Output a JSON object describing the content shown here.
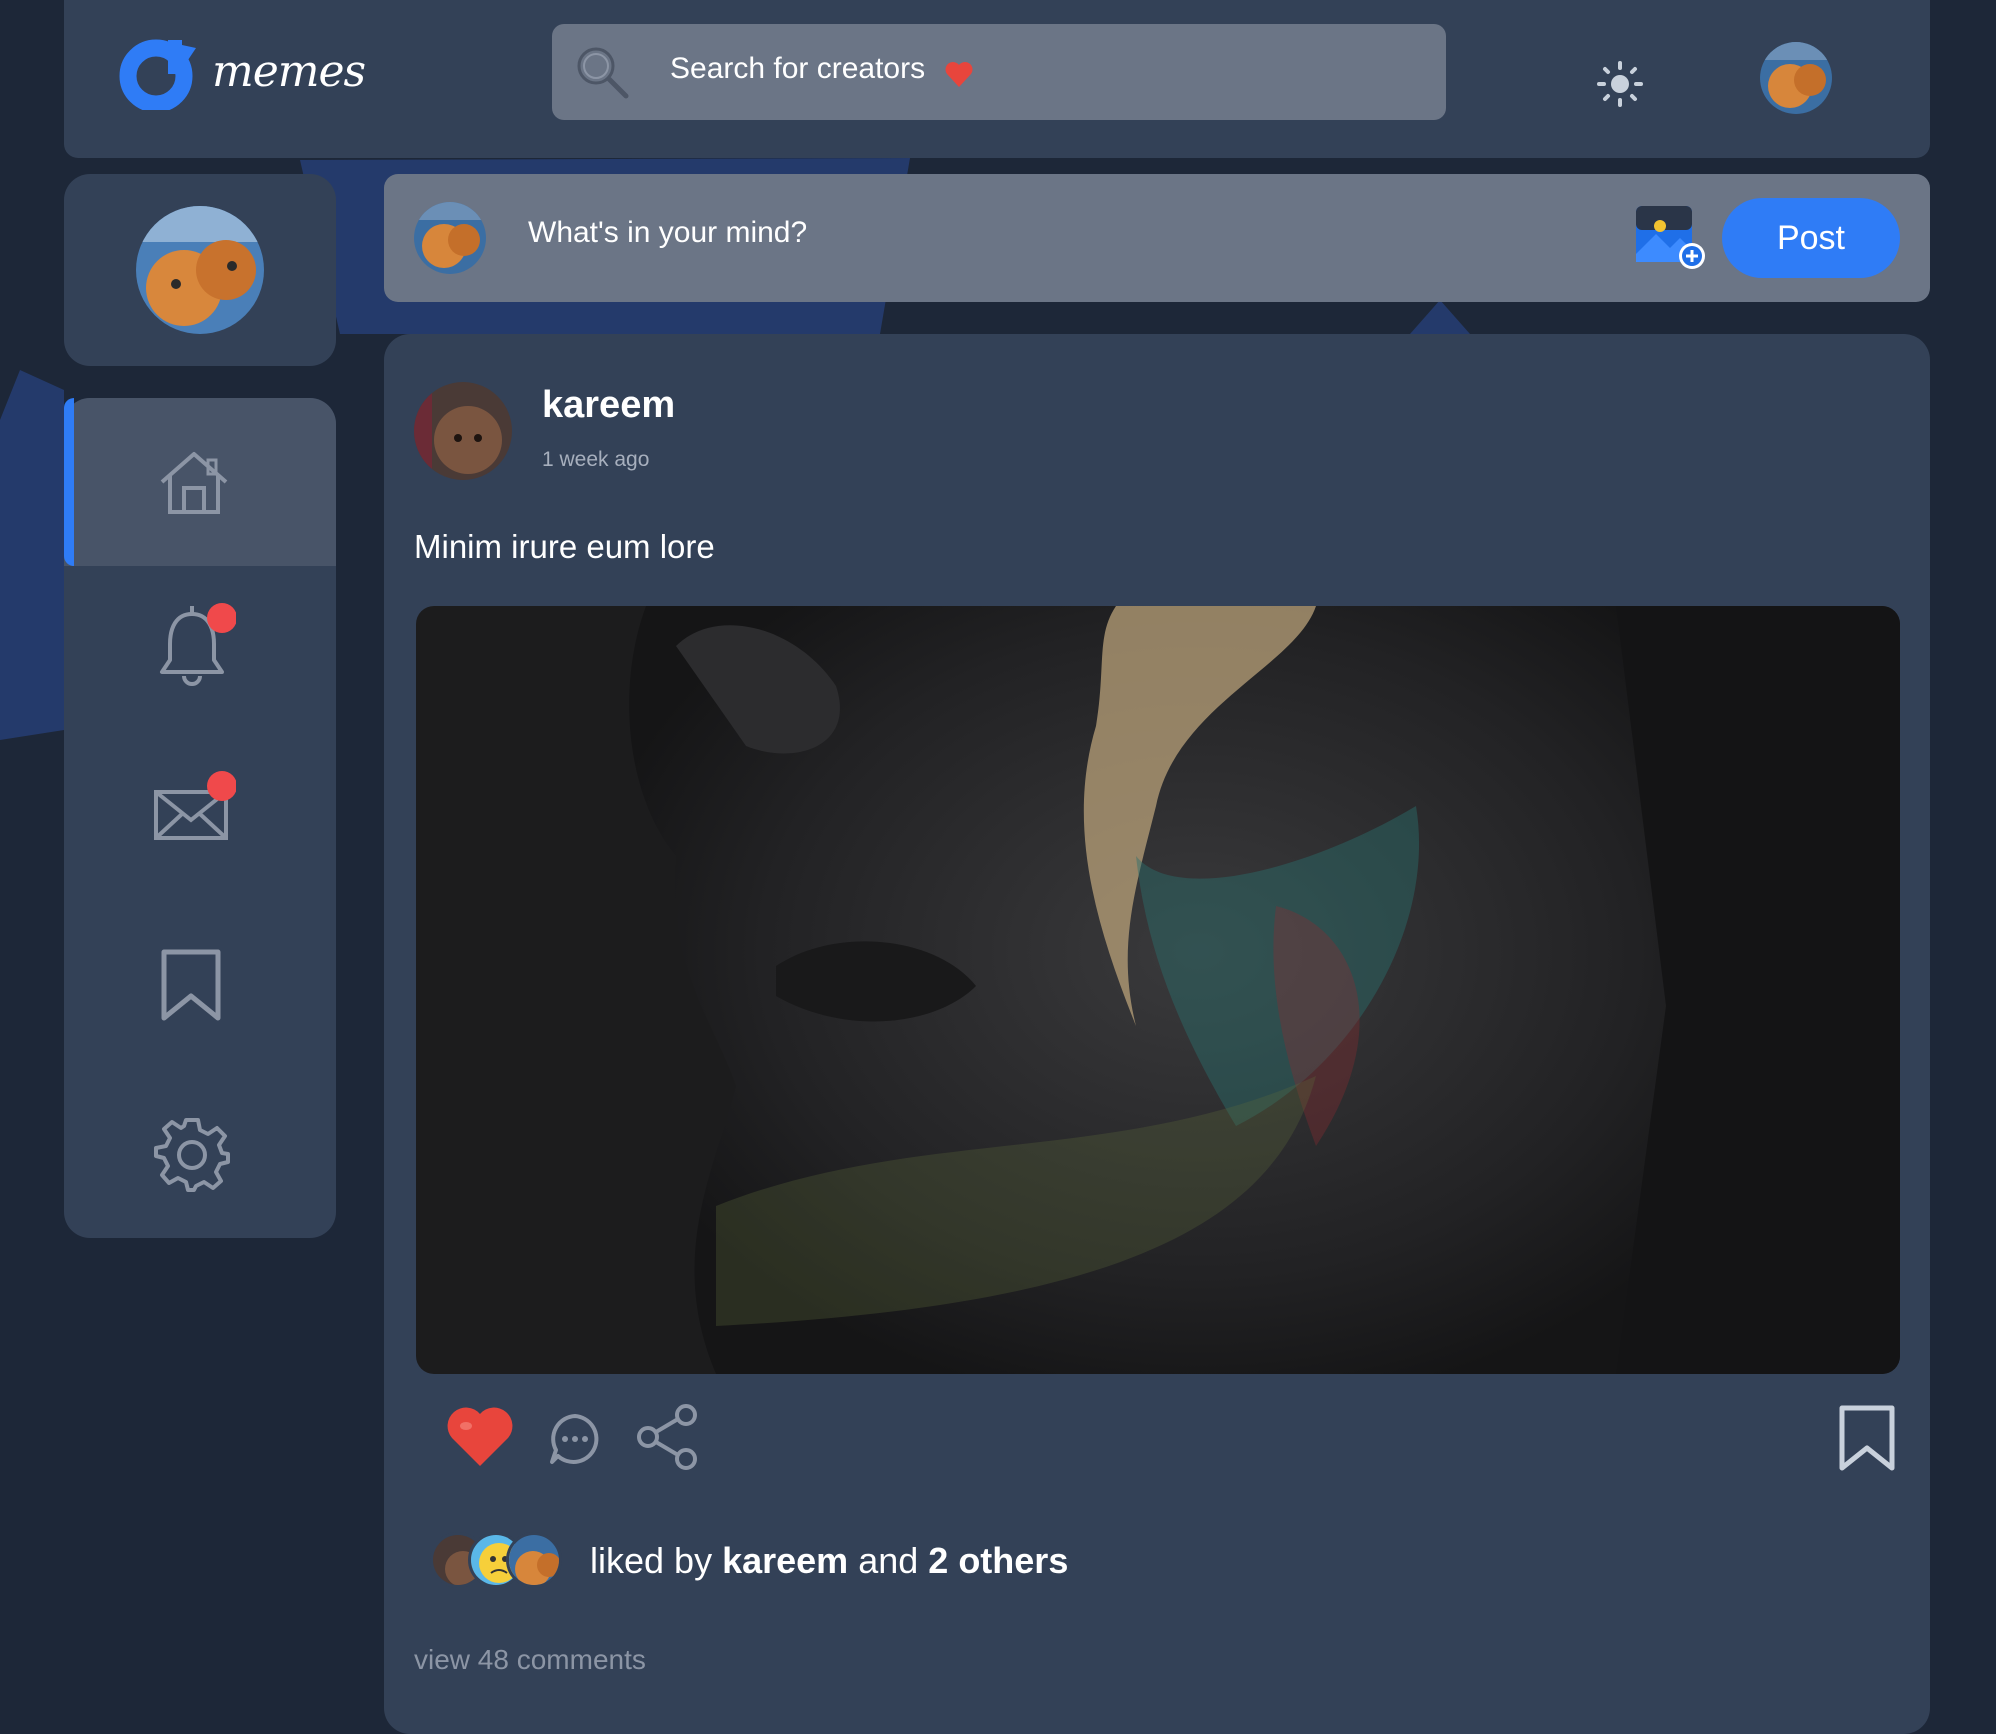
{
  "app": {
    "logo_text": "memes"
  },
  "search": {
    "placeholder": "Search for creators"
  },
  "composer": {
    "placeholder": "What's in your mind?",
    "post_label": "Post"
  },
  "sidebar": {
    "items": [
      {
        "name": "home",
        "icon": "home-icon",
        "active": true
      },
      {
        "name": "notifications",
        "icon": "bell-icon",
        "badge": true
      },
      {
        "name": "messages",
        "icon": "mail-icon",
        "badge": true
      },
      {
        "name": "saved",
        "icon": "bookmark-icon"
      },
      {
        "name": "settings",
        "icon": "gear-icon"
      }
    ]
  },
  "post": {
    "author": "kareem",
    "time": "1 week ago",
    "text": "Minim irure eum lore",
    "liked": true,
    "likes": {
      "prefix": "liked by",
      "name": "kareem",
      "joiner": "and",
      "others": "2 others"
    },
    "comments_link": "view 48 comments"
  },
  "colors": {
    "accent": "#2f7cf6",
    "background": "#1d2738",
    "card": "#334157",
    "heart": "#e8453c",
    "badge": "#f0494b"
  }
}
